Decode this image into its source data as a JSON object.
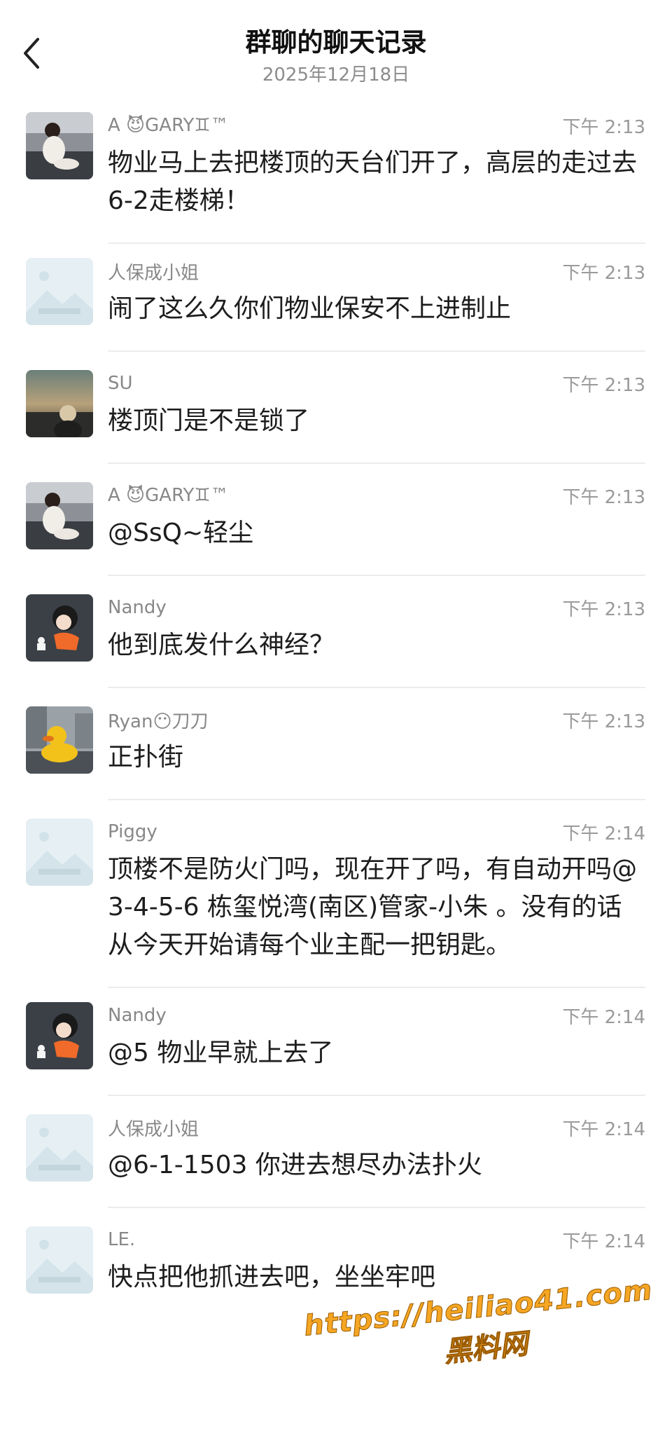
{
  "header": {
    "title": "群聊的聊天记录",
    "date": "2025年12月18日"
  },
  "messages": [
    {
      "sender": "A  😈GARY♊™",
      "time": "下午 2:13",
      "text": "物业马上去把楼顶的天台们开了，高层的走过去6-2走楼梯！",
      "avatar_icon": "photo-child-avatar"
    },
    {
      "sender": "人保成小姐",
      "time": "下午 2:13",
      "text": "闹了这么久你们物业保安不上进制止",
      "avatar_icon": "default-placeholder-avatar"
    },
    {
      "sender": "SU",
      "time": "下午 2:13",
      "text": "楼顶门是不是锁了",
      "avatar_icon": "photo-sunset-avatar"
    },
    {
      "sender": "A  😈GARY♊™",
      "time": "下午 2:13",
      "text": "@SsQ~轻尘",
      "avatar_icon": "photo-child-avatar"
    },
    {
      "sender": "Nandy",
      "time": "下午 2:13",
      "text": "他到底发什么神经？",
      "avatar_icon": "cartoon-girl-avatar"
    },
    {
      "sender": "Ryan😶刀刀",
      "time": "下午 2:13",
      "text": "正扑街",
      "avatar_icon": "rubber-duck-avatar"
    },
    {
      "sender": "Piggy",
      "time": "下午 2:14",
      "text": "顶楼不是防火门吗，现在开了吗，有自动开吗@3-4-5-6 栋玺悦湾(南区)管家-小朱 。没有的话从今天开始请每个业主配一把钥匙。",
      "avatar_icon": "default-placeholder-avatar"
    },
    {
      "sender": "Nandy",
      "time": "下午 2:14",
      "text": "@5 物业早就上去了",
      "avatar_icon": "cartoon-girl-avatar"
    },
    {
      "sender": "人保成小姐",
      "time": "下午 2:14",
      "text": "@6-1-1503 你进去想尽办法扑火",
      "avatar_icon": "default-placeholder-avatar"
    },
    {
      "sender": "LE.",
      "time": "下午 2:14",
      "text": "快点把他抓进去吧，坐坐牢吧",
      "avatar_icon": "default-placeholder-avatar"
    }
  ],
  "watermark": {
    "url": "https://heiliao41.com",
    "label": "黑料网"
  },
  "colors": {
    "background": "#ffffff",
    "sender": "#888888",
    "time": "#9a9a9a",
    "divider": "#ececec",
    "watermark": "#f5a623"
  }
}
